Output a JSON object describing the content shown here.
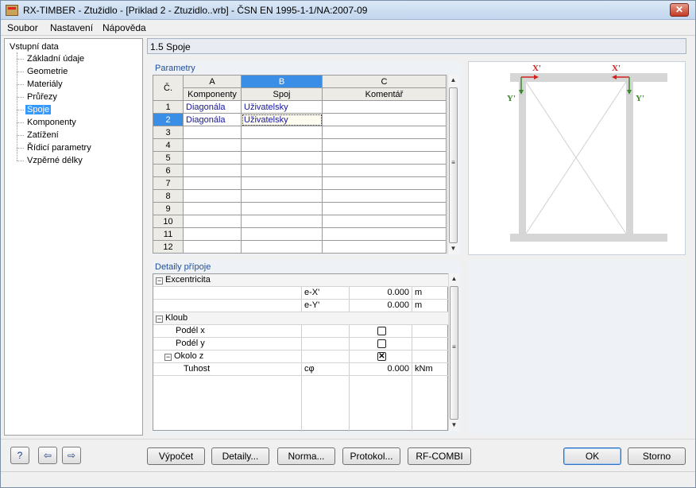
{
  "window": {
    "title": "RX-TIMBER - Ztužidlo - [Priklad 2 - Ztuzidlo..vrb] - ČSN EN 1995-1-1/NA:2007-09",
    "close_glyph": "✕"
  },
  "menu": [
    "Soubor",
    "Nastavení",
    "Nápověda"
  ],
  "nav": {
    "root": "Vstupní data",
    "items": [
      "Základní údaje",
      "Geometrie",
      "Materiály",
      "Průřezy",
      "Spoje",
      "Komponenty",
      "Zatížení",
      "Řídicí parametry",
      "Vzpěrné délky"
    ],
    "selected_index": 4
  },
  "section_title": "1.5 Spoje",
  "params": {
    "label": "Parametry",
    "col_letters": [
      "A",
      "B",
      "C"
    ],
    "row_header": "Č.",
    "col_headers": [
      "Komponenty",
      "Spoj",
      "Komentář"
    ],
    "rows": [
      {
        "n": "1",
        "a": "Diagonála",
        "b": "Uživatelsky",
        "c": ""
      },
      {
        "n": "2",
        "a": "Diagonála",
        "b": "Uživatelsky",
        "c": ""
      },
      {
        "n": "3",
        "a": "",
        "b": "",
        "c": ""
      },
      {
        "n": "4",
        "a": "",
        "b": "",
        "c": ""
      },
      {
        "n": "5",
        "a": "",
        "b": "",
        "c": ""
      },
      {
        "n": "6",
        "a": "",
        "b": "",
        "c": ""
      },
      {
        "n": "7",
        "a": "",
        "b": "",
        "c": ""
      },
      {
        "n": "8",
        "a": "",
        "b": "",
        "c": ""
      },
      {
        "n": "9",
        "a": "",
        "b": "",
        "c": ""
      },
      {
        "n": "10",
        "a": "",
        "b": "",
        "c": ""
      },
      {
        "n": "11",
        "a": "",
        "b": "",
        "c": ""
      },
      {
        "n": "12",
        "a": "",
        "b": "",
        "c": ""
      }
    ],
    "selected_row": 1,
    "selected_col": 1
  },
  "details": {
    "label": "Detaily přípoje",
    "excentricita": {
      "label": "Excentricita",
      "ex_label": "e-X'",
      "ex_value": "0.000",
      "ex_unit": "m",
      "ey_label": "e-Y'",
      "ey_value": "0.000",
      "ey_unit": "m"
    },
    "kloub": {
      "label": "Kloub",
      "podel_x": "Podél x",
      "podel_x_checked": false,
      "podel_y": "Podél y",
      "podel_y_checked": false,
      "okolo_z": "Okolo z",
      "okolo_z_checked": true,
      "tuhost": "Tuhost",
      "tuhost_symbol": "cφ",
      "tuhost_value": "0.000",
      "tuhost_unit": "kNm"
    }
  },
  "preview": {
    "x_left": "X'",
    "y_left": "Y'",
    "x_right": "X'",
    "y_right": "Y'",
    "colors": {
      "x_axis": "#d32020",
      "y_axis": "#3a8a2a",
      "member": "#d6d6d6",
      "diagonal": "#d0d0d0"
    }
  },
  "buttons": {
    "vypocet": "Výpočet",
    "detaily": "Detaily...",
    "norma": "Norma...",
    "protokol": "Protokol...",
    "rfcombi": "RF-COMBI",
    "ok": "OK",
    "storno": "Storno"
  },
  "icons": {
    "help": "?",
    "import": "⇦",
    "export": "⇨"
  },
  "scroll_glyphs": {
    "up": "▲",
    "down": "▼",
    "grip": "≡"
  },
  "tree_glyphs": {
    "collapse": "−",
    "check": "✕"
  }
}
